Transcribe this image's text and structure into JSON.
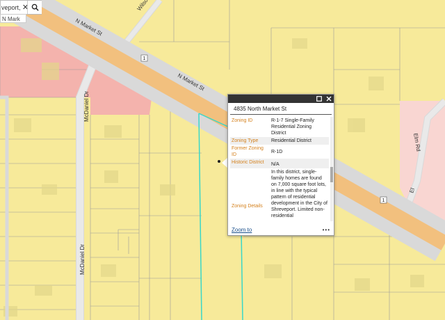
{
  "search": {
    "value": "veport, L",
    "clear_glyph": "✕",
    "suggestion": "N Mark"
  },
  "icons": {
    "search": "search-icon",
    "clear": "close-icon",
    "maximize": "maximize-icon",
    "close": "close-icon",
    "more": "more-dots-icon"
  },
  "map": {
    "colors": {
      "residential": "#f7ea9a",
      "commercial": "#f4b3ad",
      "pink_light": "#f9d6d2",
      "road_major": "#f2c07e",
      "road_edge": "#d9d9d9",
      "road_minor": "#e9e9e9",
      "parcel_line": "#9a9a9a",
      "highlight": "#39d7c9"
    },
    "labels": {
      "n_market_1": "N Market St",
      "n_market_2": "N Market St",
      "wilson": "Wilson",
      "mcdaniel_1": "McDaniel Dr",
      "mcdaniel_2": "McDaniel Dr",
      "elm": "Elm Rd",
      "el": "El",
      "route1": "1",
      "route2": "1"
    }
  },
  "popup": {
    "title": "4835 North Market St",
    "attributes": [
      {
        "key": "Zoning ID",
        "value": "R-1-7 Single-Family Residential Zoning District"
      },
      {
        "key": "Zoning Type",
        "value": "Residential District"
      },
      {
        "key": "Former Zoning ID",
        "value": "R-1D"
      },
      {
        "key": "Historic District",
        "value": "N/A"
      },
      {
        "key": "Zoning Details",
        "value": "In this district, single-family homes are found on 7,000 square foot lots, in line with the typical pattern of residential development in the City of Shreveport. Limited non-residential"
      }
    ],
    "zoom_label": "Zoom to",
    "more_label": "•••"
  }
}
